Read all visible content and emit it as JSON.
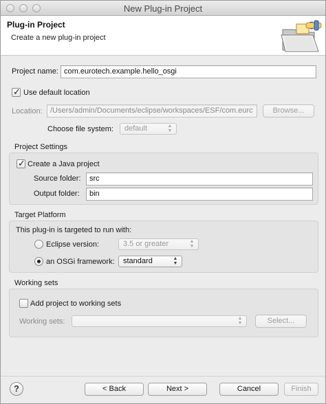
{
  "window": {
    "title": "New Plug-in Project"
  },
  "banner": {
    "title": "Plug-in Project",
    "subtitle": "Create a new plug-in project",
    "icon": "folder-wizard-icon"
  },
  "project_name": {
    "label": "Project name:",
    "value": "com.eurotech.example.hello_osgi"
  },
  "use_default_location": {
    "label": "Use default location",
    "checked": true
  },
  "location": {
    "label": "Location:",
    "value": "/Users/admin/Documents/eclipse/workspaces/ESF/com.eurc",
    "browse_label": "Browse..."
  },
  "file_system": {
    "label": "Choose file system:",
    "selected": "default"
  },
  "project_settings": {
    "title": "Project Settings",
    "java_project": {
      "label": "Create a Java project",
      "checked": true
    },
    "source_folder": {
      "label": "Source folder:",
      "value": "src"
    },
    "output_folder": {
      "label": "Output folder:",
      "value": "bin"
    }
  },
  "target_platform": {
    "title": "Target Platform",
    "intro": "This plug-in is targeted to run with:",
    "eclipse": {
      "label": "Eclipse version:",
      "selected": "3.5 or greater"
    },
    "osgi": {
      "label": "an OSGi framework:",
      "selected": "standard",
      "checked": true
    }
  },
  "working_sets": {
    "title": "Working sets",
    "add": {
      "label": "Add project to working sets",
      "checked": false
    },
    "sets_label": "Working sets:",
    "select_label": "Select..."
  },
  "footer": {
    "help": "?",
    "back": "< Back",
    "next": "Next >",
    "cancel": "Cancel",
    "finish": "Finish"
  }
}
